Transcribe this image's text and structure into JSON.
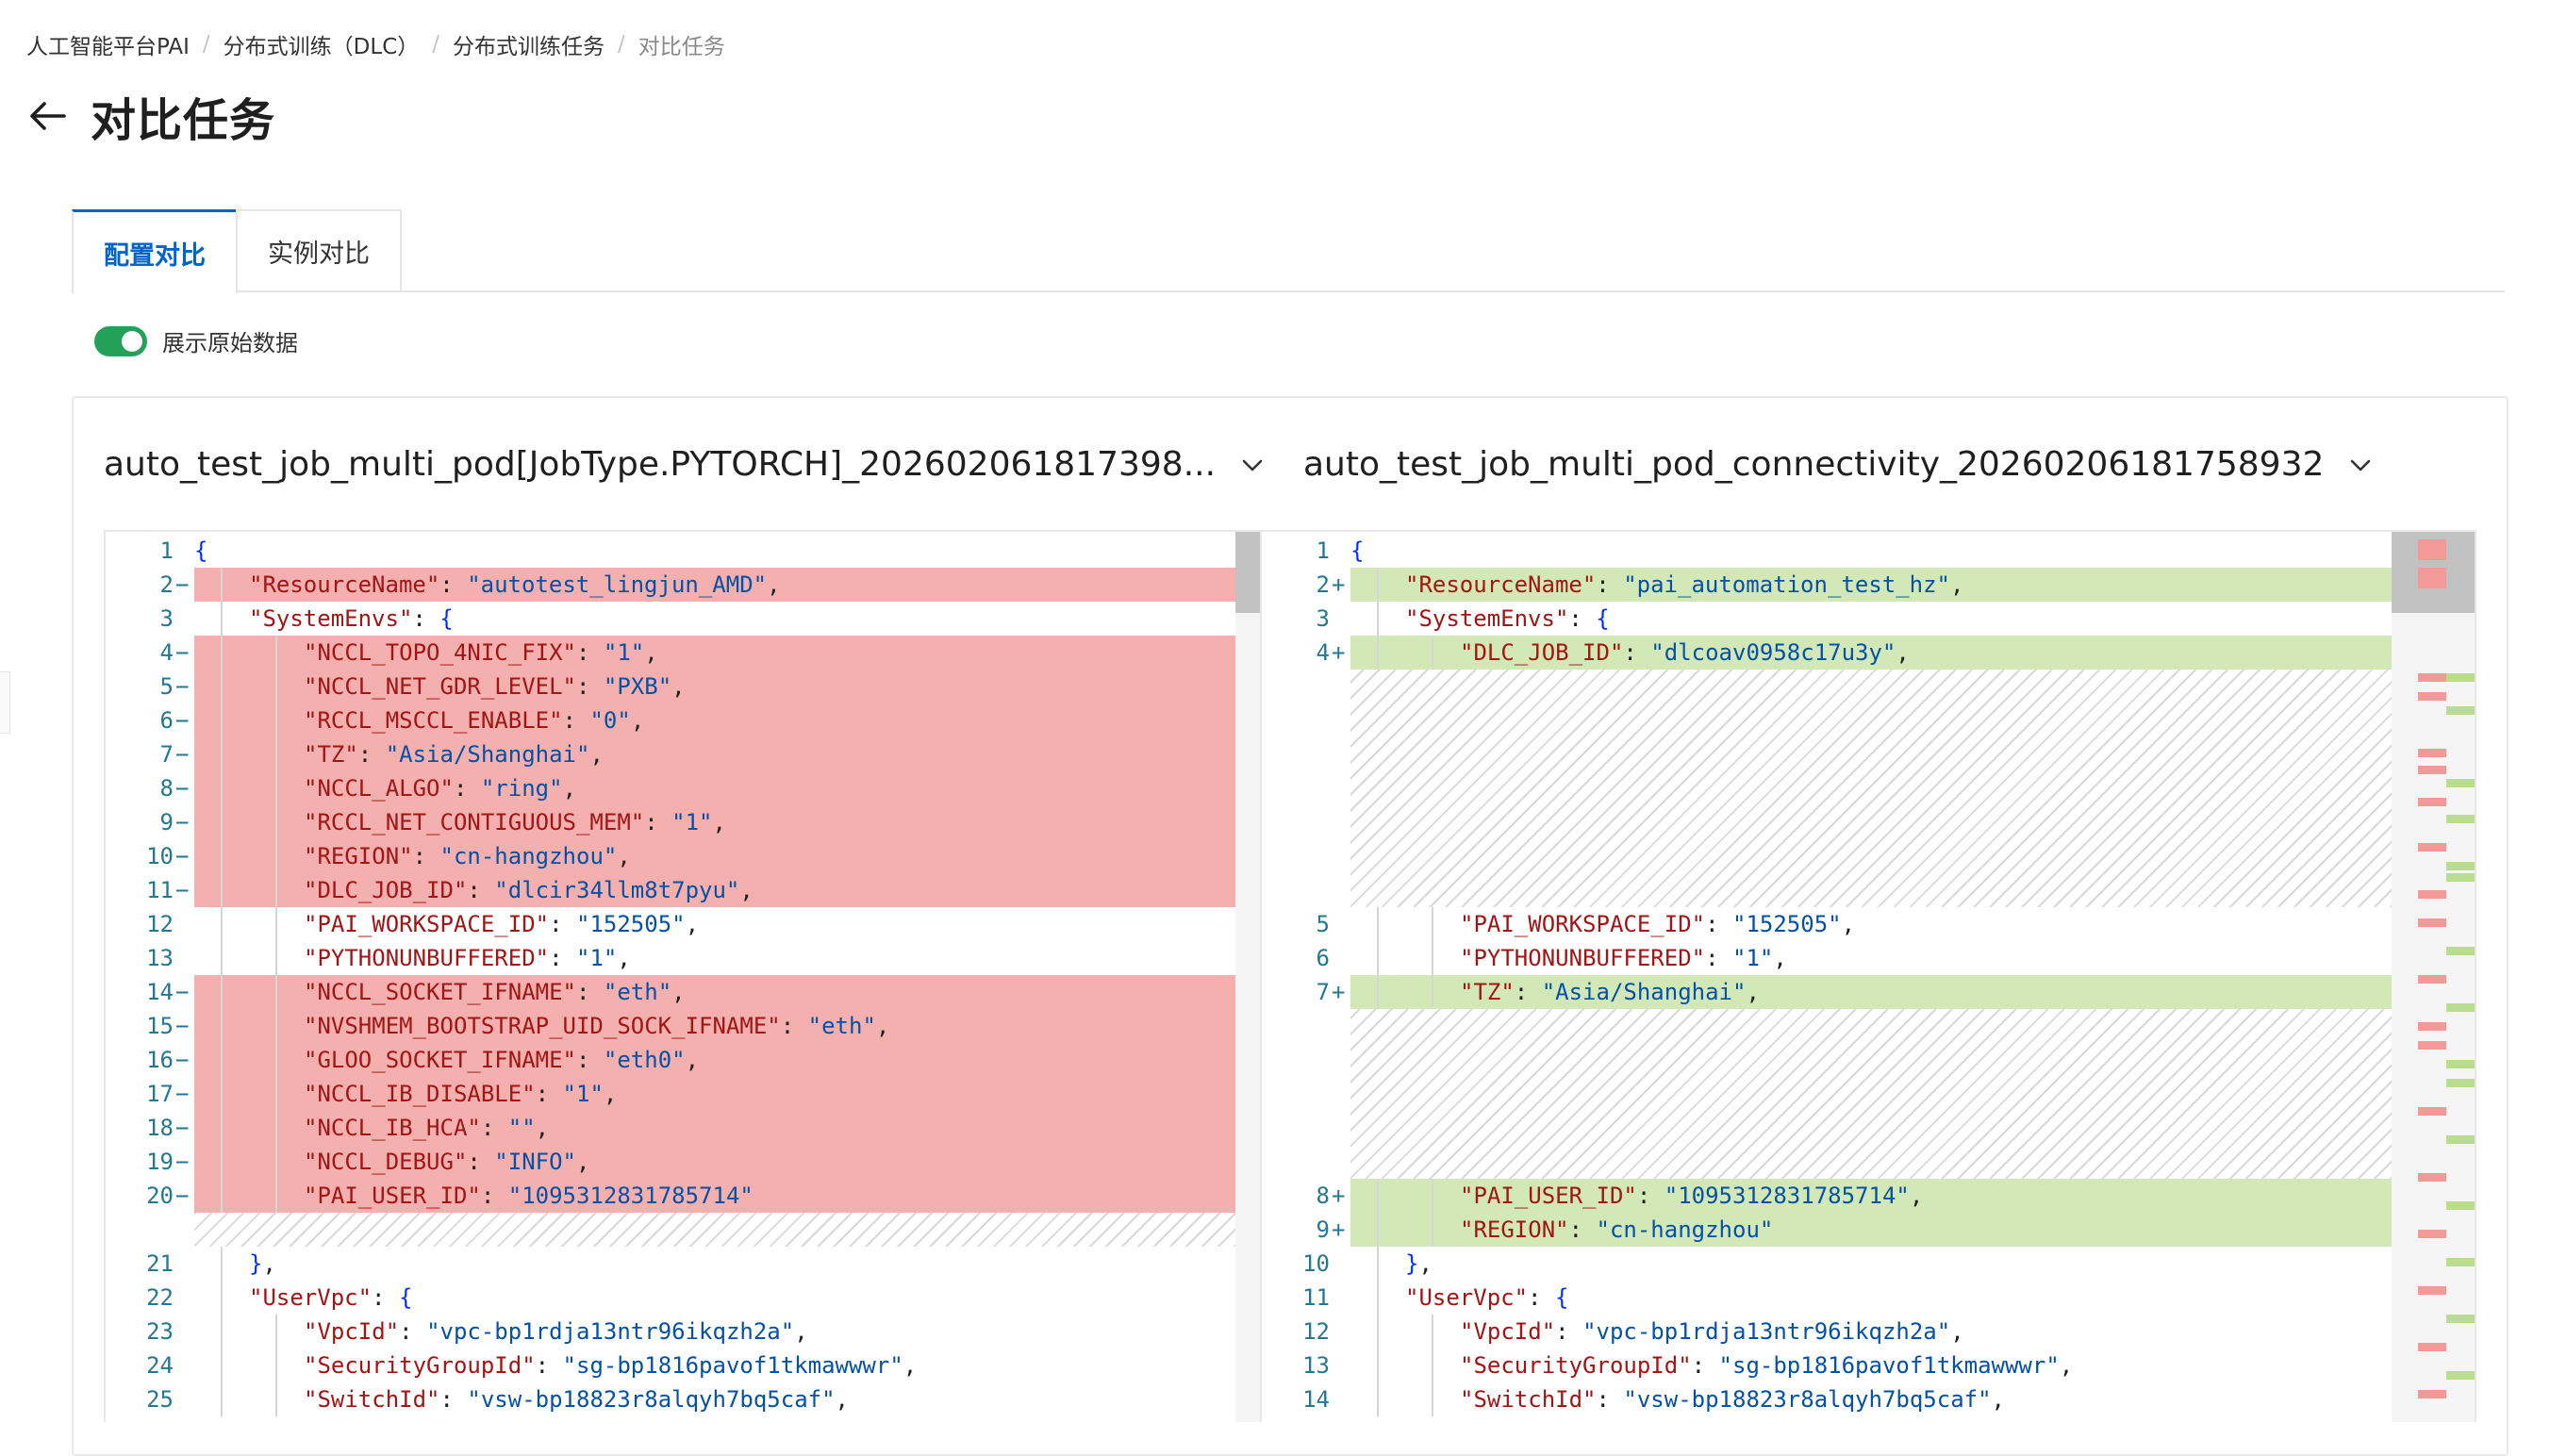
{
  "breadcrumb": {
    "items": [
      "人工智能平台PAI",
      "分布式训练（DLC）",
      "分布式训练任务",
      "对比任务"
    ],
    "separator": "/"
  },
  "page": {
    "title": "对比任务"
  },
  "tabs": {
    "items": [
      {
        "label": "配置对比",
        "active": true
      },
      {
        "label": "实例对比",
        "active": false
      }
    ]
  },
  "toggle": {
    "label": "展示原始数据",
    "checked": true
  },
  "compare": {
    "left_job": "auto_test_job_multi_pod[JobType.PYTORCH]_202602061817398...",
    "right_job": "auto_test_job_multi_pod_connectivity_20260206181758932"
  },
  "diff": {
    "left": [
      {
        "n": "1",
        "m": "",
        "t": "{"
      },
      {
        "n": "2",
        "m": "−",
        "t": "\"ResourceName\": \"autotest_lingjun_AMD\","
      },
      {
        "n": "3",
        "m": "",
        "t": "\"SystemEnvs\": {"
      },
      {
        "n": "4",
        "m": "−",
        "t": "\"NCCL_TOPO_4NIC_FIX\": \"1\","
      },
      {
        "n": "5",
        "m": "−",
        "t": "\"NCCL_NET_GDR_LEVEL\": \"PXB\","
      },
      {
        "n": "6",
        "m": "−",
        "t": "\"RCCL_MSCCL_ENABLE\": \"0\","
      },
      {
        "n": "7",
        "m": "−",
        "t": "\"TZ\": \"Asia/Shanghai\","
      },
      {
        "n": "8",
        "m": "−",
        "t": "\"NCCL_ALGO\": \"ring\","
      },
      {
        "n": "9",
        "m": "−",
        "t": "\"RCCL_NET_CONTIGUOUS_MEM\": \"1\","
      },
      {
        "n": "10",
        "m": "−",
        "t": "\"REGION\": \"cn-hangzhou\","
      },
      {
        "n": "11",
        "m": "−",
        "t": "\"DLC_JOB_ID\": \"dlcir34llm8t7pyu\","
      },
      {
        "n": "12",
        "m": "",
        "t": "\"PAI_WORKSPACE_ID\": \"152505\","
      },
      {
        "n": "13",
        "m": "",
        "t": "\"PYTHONUNBUFFERED\": \"1\","
      },
      {
        "n": "14",
        "m": "−",
        "t": "\"NCCL_SOCKET_IFNAME\": \"eth\","
      },
      {
        "n": "15",
        "m": "−",
        "t": "\"NVSHMEM_BOOTSTRAP_UID_SOCK_IFNAME\": \"eth\","
      },
      {
        "n": "16",
        "m": "−",
        "t": "\"GLOO_SOCKET_IFNAME\": \"eth0\","
      },
      {
        "n": "17",
        "m": "−",
        "t": "\"NCCL_IB_DISABLE\": \"1\","
      },
      {
        "n": "18",
        "m": "−",
        "t": "\"NCCL_IB_HCA\": \"\","
      },
      {
        "n": "19",
        "m": "−",
        "t": "\"NCCL_DEBUG\": \"INFO\","
      },
      {
        "n": "20",
        "m": "−",
        "t": "\"PAI_USER_ID\": \"1095312831785714\""
      },
      {
        "n": "21",
        "m": "",
        "t": "},"
      },
      {
        "n": "22",
        "m": "",
        "t": "\"UserVpc\": {"
      },
      {
        "n": "23",
        "m": "",
        "t": "\"VpcId\": \"vpc-bp1rdja13ntr96ikqzh2a\","
      },
      {
        "n": "24",
        "m": "",
        "t": "\"SecurityGroupId\": \"sg-bp1816pavof1tkmawwwr\","
      },
      {
        "n": "25",
        "m": "",
        "t": "\"SwitchId\": \"vsw-bp18823r8alqyh7bq5caf\","
      }
    ],
    "right": [
      {
        "n": "1",
        "m": "",
        "t": "{"
      },
      {
        "n": "2",
        "m": "+",
        "t": "\"ResourceName\": \"pai_automation_test_hz\","
      },
      {
        "n": "3",
        "m": "",
        "t": "\"SystemEnvs\": {"
      },
      {
        "n": "4",
        "m": "+",
        "t": "\"DLC_JOB_ID\": \"dlcoav0958c17u3y\","
      },
      {
        "n": "5",
        "m": "",
        "t": "\"PAI_WORKSPACE_ID\": \"152505\","
      },
      {
        "n": "6",
        "m": "",
        "t": "\"PYTHONUNBUFFERED\": \"1\","
      },
      {
        "n": "7",
        "m": "+",
        "t": "\"TZ\": \"Asia/Shanghai\","
      },
      {
        "n": "8",
        "m": "+",
        "t": "\"PAI_USER_ID\": \"1095312831785714\","
      },
      {
        "n": "9",
        "m": "+",
        "t": "\"REGION\": \"cn-hangzhou\""
      },
      {
        "n": "10",
        "m": "",
        "t": "},"
      },
      {
        "n": "11",
        "m": "",
        "t": "\"UserVpc\": {"
      },
      {
        "n": "12",
        "m": "",
        "t": "\"VpcId\": \"vpc-bp1rdja13ntr96ikqzh2a\","
      },
      {
        "n": "13",
        "m": "",
        "t": "\"SecurityGroupId\": \"sg-bp1816pavof1tkmawwwr\","
      },
      {
        "n": "14",
        "m": "",
        "t": "\"SwitchId\": \"vsw-bp18823r8alqyh7bq5caf\","
      }
    ]
  },
  "colors": {
    "accent": "#0064c8",
    "toggle_on": "#23a15a",
    "deleted": "#f3b0ae",
    "added": "#d3e8b7",
    "json_key": "#a31515",
    "json_string": "#0451a5"
  }
}
